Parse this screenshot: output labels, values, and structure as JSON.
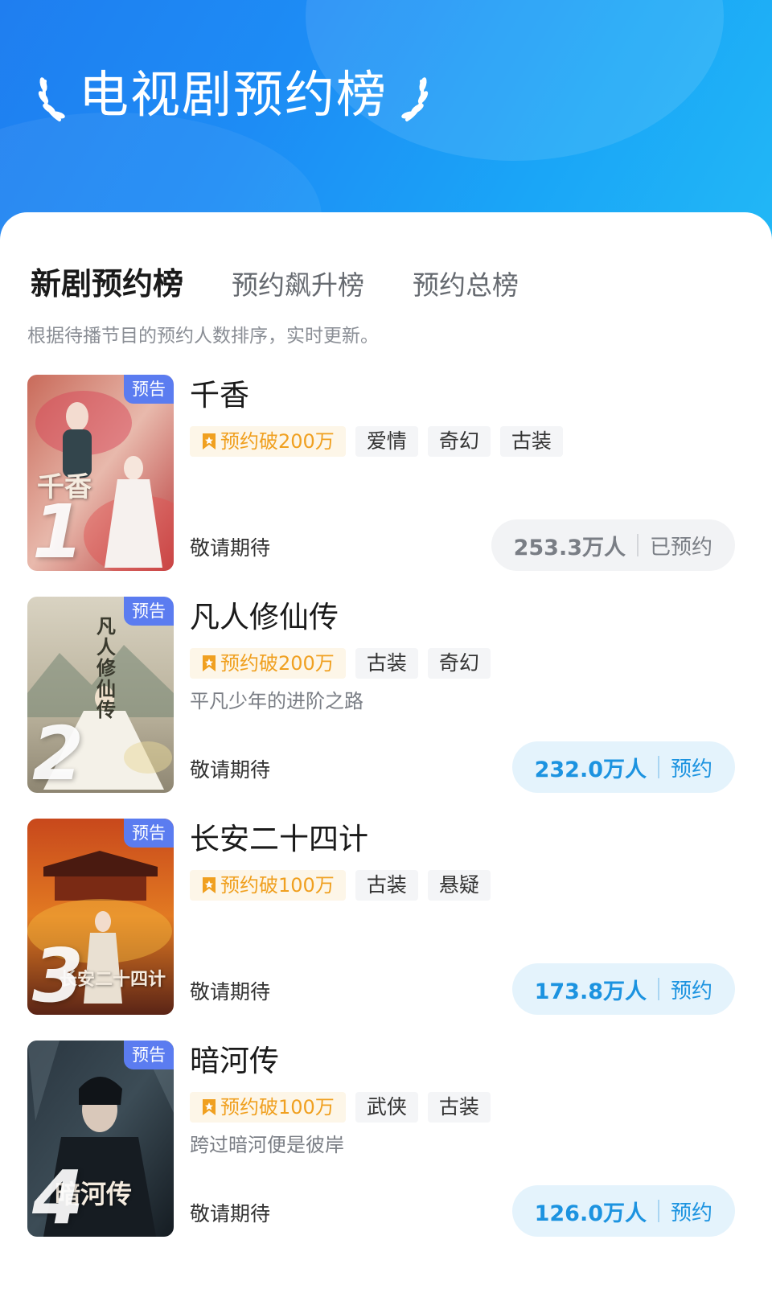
{
  "header": {
    "title": "电视剧预约榜",
    "gradient_start": "#1f7ef0",
    "gradient_end": "#22b8f6"
  },
  "tabs": [
    {
      "label": "新剧预约榜",
      "active": true
    },
    {
      "label": "预约飙升榜",
      "active": false
    },
    {
      "label": "预约总榜",
      "active": false
    }
  ],
  "subtitle": "根据待播节目的预约人数排序，实时更新。",
  "items": [
    {
      "rank": "1",
      "preview_tag": "预告",
      "poster_script": "千香",
      "title": "千香",
      "badge": "预约破200万",
      "genres": [
        "爱情",
        "奇幻",
        "古装"
      ],
      "desc": "",
      "status": "敬请期待",
      "count": "253.3万人",
      "action": "已预约",
      "reserved": true
    },
    {
      "rank": "2",
      "preview_tag": "预告",
      "poster_script": "凡人修仙传",
      "title": "凡人修仙传",
      "badge": "预约破200万",
      "genres": [
        "古装",
        "奇幻"
      ],
      "desc": "平凡少年的进阶之路",
      "status": "敬请期待",
      "count": "232.0万人",
      "action": "预约",
      "reserved": false
    },
    {
      "rank": "3",
      "preview_tag": "预告",
      "poster_script": "长安二十四计",
      "title": "长安二十四计",
      "badge": "预约破100万",
      "genres": [
        "古装",
        "悬疑"
      ],
      "desc": "",
      "status": "敬请期待",
      "count": "173.8万人",
      "action": "预约",
      "reserved": false
    },
    {
      "rank": "4",
      "preview_tag": "预告",
      "poster_script": "暗河传",
      "title": "暗河传",
      "badge": "预约破100万",
      "genres": [
        "武侠",
        "古装"
      ],
      "desc": "跨过暗河便是彼岸",
      "status": "敬请期待",
      "count": "126.0万人",
      "action": "预约",
      "reserved": false
    }
  ],
  "icons": {
    "laurel_left": "laurel-left-icon",
    "laurel_right": "laurel-right-icon",
    "badge": "bookmark-star-icon"
  },
  "colors": {
    "accent_blue": "#1c93e0",
    "badge_orange": "#f0a020",
    "preview_tag": "#5b7cf0"
  }
}
